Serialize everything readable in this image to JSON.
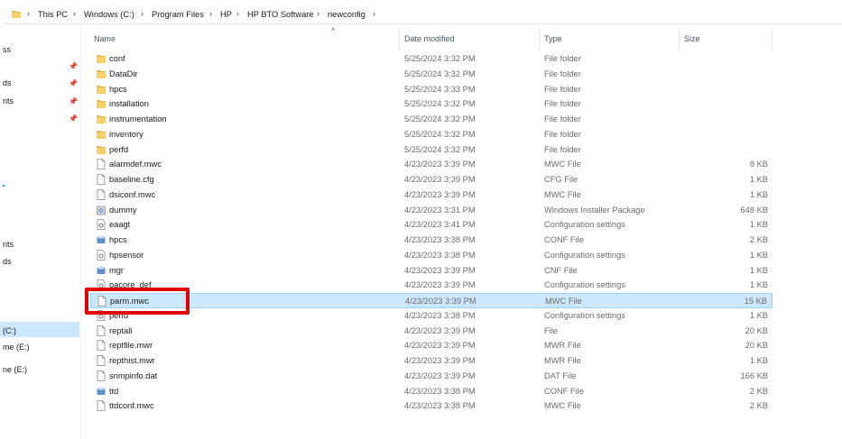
{
  "breadcrumb": [
    "This PC",
    "Windows (C:)",
    "Program Files",
    "HP",
    "HP BTO Software",
    "newconfig"
  ],
  "columns": {
    "name": "Name",
    "date": "Date modified",
    "type": "Type",
    "size": "Size"
  },
  "nav": [
    {
      "label": "ss",
      "pin": false
    },
    {
      "label": "ds",
      "pin": true
    },
    {
      "label": "nts",
      "pin": true
    },
    {
      "label": "nts",
      "pin": false
    },
    {
      "label": "ds",
      "pin": false
    },
    {
      "label": "(C:)",
      "selected": true
    },
    {
      "label": "me (E:)"
    },
    {
      "label": "ne (E:)"
    }
  ],
  "files": [
    {
      "name": "conf",
      "date": "5/25/2024 3:32 PM",
      "type": "File folder",
      "size": "",
      "icon": "folder-icon"
    },
    {
      "name": "DataDir",
      "date": "5/25/2024 3:32 PM",
      "type": "File folder",
      "size": "",
      "icon": "folder-icon"
    },
    {
      "name": "hpcs",
      "date": "5/25/2024 3:33 PM",
      "type": "File folder",
      "size": "",
      "icon": "folder-icon"
    },
    {
      "name": "installation",
      "date": "5/25/2024 3:32 PM",
      "type": "File folder",
      "size": "",
      "icon": "folder-icon"
    },
    {
      "name": "instrumentation",
      "date": "5/25/2024 3:32 PM",
      "type": "File folder",
      "size": "",
      "icon": "folder-icon"
    },
    {
      "name": "inventory",
      "date": "5/25/2024 3:32 PM",
      "type": "File folder",
      "size": "",
      "icon": "folder-icon"
    },
    {
      "name": "perfd",
      "date": "5/25/2024 3:32 PM",
      "type": "File folder",
      "size": "",
      "icon": "folder-icon"
    },
    {
      "name": "alarmdef.mwc",
      "date": "4/23/2023 3:39 PM",
      "type": "MWC File",
      "size": "8 KB",
      "icon": "file-icon"
    },
    {
      "name": "baseline.cfg",
      "date": "4/23/2023 3:39 PM",
      "type": "CFG File",
      "size": "1 KB",
      "icon": "file-icon"
    },
    {
      "name": "dsiconf.mwc",
      "date": "4/23/2023 3:39 PM",
      "type": "MWC File",
      "size": "1 KB",
      "icon": "file-icon"
    },
    {
      "name": "dummy",
      "date": "4/23/2023 3:31 PM",
      "type": "Windows Installer Package",
      "size": "648 KB",
      "icon": "installer-icon"
    },
    {
      "name": "eaagt",
      "date": "4/23/2023 3:41 PM",
      "type": "Configuration settings",
      "size": "1 KB",
      "icon": "settings-file-icon"
    },
    {
      "name": "hpcs",
      "date": "4/23/2023 3:38 PM",
      "type": "CONF File",
      "size": "2 KB",
      "icon": "conf-file-icon"
    },
    {
      "name": "hpsensor",
      "date": "4/23/2023 3:38 PM",
      "type": "Configuration settings",
      "size": "1 KB",
      "icon": "settings-file-icon"
    },
    {
      "name": "mgr",
      "date": "4/23/2023 3:39 PM",
      "type": "CNF File",
      "size": "1 KB",
      "icon": "conf-file-icon"
    },
    {
      "name": "oacore_def",
      "date": "4/23/2023 3:39 PM",
      "type": "Configuration settings",
      "size": "1 KB",
      "icon": "settings-file-icon"
    },
    {
      "name": "parm.mwc",
      "date": "4/23/2023 3:39 PM",
      "type": "MWC File",
      "size": "15 KB",
      "icon": "file-icon",
      "selected": true
    },
    {
      "name": "perfd",
      "date": "4/23/2023 3:38 PM",
      "type": "Configuration settings",
      "size": "1 KB",
      "icon": "settings-file-icon"
    },
    {
      "name": "reptall",
      "date": "4/23/2023 3:39 PM",
      "type": "File",
      "size": "20 KB",
      "icon": "file-icon"
    },
    {
      "name": "reptfile.mwr",
      "date": "4/23/2023 3:39 PM",
      "type": "MWR File",
      "size": "20 KB",
      "icon": "file-icon"
    },
    {
      "name": "repthist.mwr",
      "date": "4/23/2023 3:39 PM",
      "type": "MWR File",
      "size": "1 KB",
      "icon": "file-icon"
    },
    {
      "name": "snmpinfo.dat",
      "date": "4/23/2023 3:39 PM",
      "type": "DAT File",
      "size": "166 KB",
      "icon": "file-icon"
    },
    {
      "name": "ttd",
      "date": "4/23/2023 3:38 PM",
      "type": "CONF File",
      "size": "2 KB",
      "icon": "conf-file-icon"
    },
    {
      "name": "ttdconf.mwc",
      "date": "4/23/2023 3:38 PM",
      "type": "MWC File",
      "size": "2 KB",
      "icon": "file-icon"
    }
  ],
  "colors": {
    "selection": "#cce8ff",
    "selection_border": "#99d1ff",
    "highlight": "#e00000",
    "folder": "#e8b84a"
  }
}
